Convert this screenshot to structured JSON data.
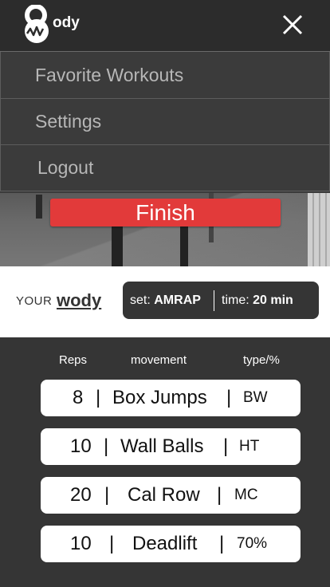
{
  "app": {
    "logo_text": "ody",
    "close_icon": "close-icon"
  },
  "menu": {
    "items": [
      {
        "label": "Favorite Workouts"
      },
      {
        "label": "Settings"
      },
      {
        "label": "Logout"
      }
    ]
  },
  "hero": {
    "finish_label": "Finish",
    "finish_color": "#e23a3a"
  },
  "wod": {
    "your_label": "YOUR",
    "wody_label": "wody",
    "set_prefix": "set:",
    "set_value": "AMRAP",
    "time_prefix": "time:",
    "time_value": "20 min"
  },
  "table": {
    "headers": {
      "reps": "Reps",
      "movement": "movement",
      "type": "type/%"
    },
    "rows": [
      {
        "reps": "8",
        "sep1": "|",
        "movement": "Box Jumps",
        "sep2": "|",
        "type": "BW"
      },
      {
        "reps": "10",
        "sep1": "|",
        "movement": "Wall Balls",
        "sep2": "|",
        "type": "HT"
      },
      {
        "reps": "20",
        "sep1": "|",
        "movement": "Cal Row",
        "sep2": "|",
        "type": "MC"
      },
      {
        "reps": "10",
        "sep1": "|",
        "movement": "Deadlift",
        "sep2": "|",
        "type": "70%"
      }
    ]
  }
}
